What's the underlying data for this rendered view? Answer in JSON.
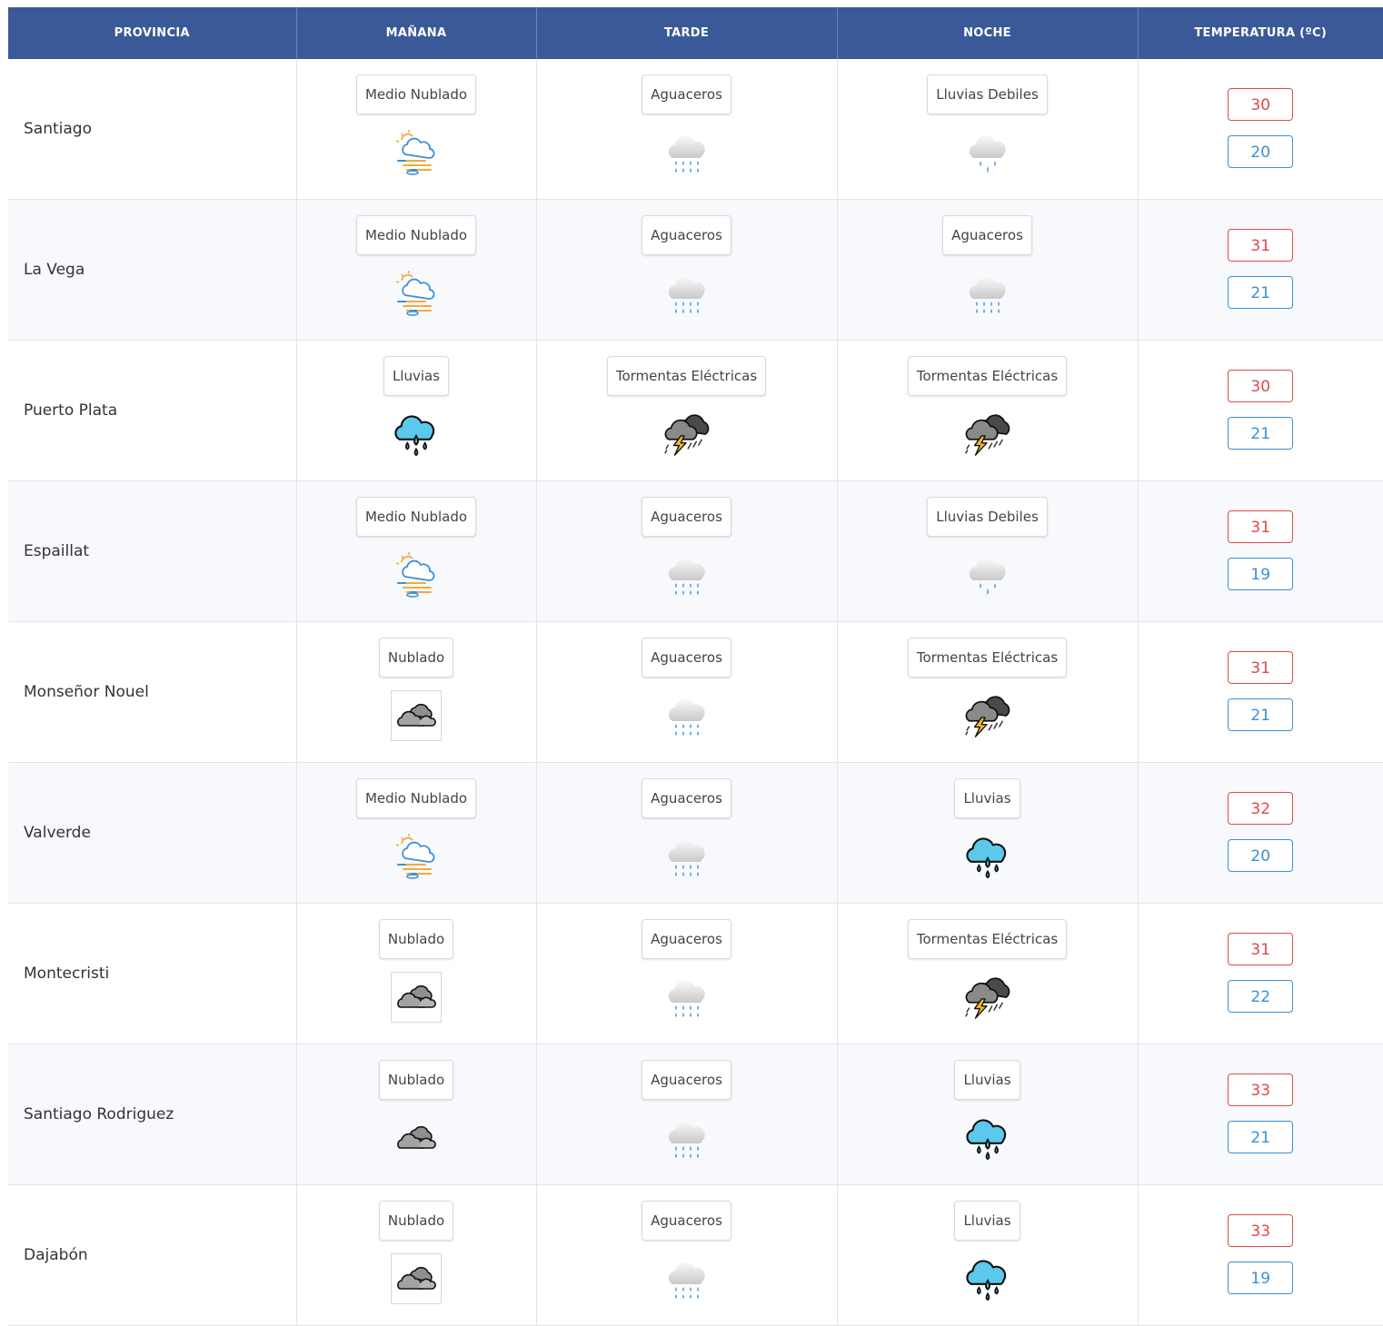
{
  "headers": {
    "provincia": "PROVINCIA",
    "manana": "MAÑANA",
    "tarde": "TARDE",
    "noche": "NOCHE",
    "temperatura": "TEMPERATURA (ºC)"
  },
  "colors": {
    "header_bg": "#3b5998",
    "max_temp": "#e0484a",
    "min_temp": "#3a8fd8"
  },
  "rows": [
    {
      "province": "Santiago",
      "manana": {
        "label": "Medio Nublado",
        "icon": "partly-cloudy-icon"
      },
      "tarde": {
        "label": "Aguaceros",
        "icon": "showers-icon"
      },
      "noche": {
        "label": "Lluvias Debiles",
        "icon": "light-rain-icon"
      },
      "max": "30",
      "min": "20"
    },
    {
      "province": "La Vega",
      "manana": {
        "label": "Medio Nublado",
        "icon": "partly-cloudy-icon"
      },
      "tarde": {
        "label": "Aguaceros",
        "icon": "showers-icon"
      },
      "noche": {
        "label": "Aguaceros",
        "icon": "showers-icon"
      },
      "max": "31",
      "min": "21"
    },
    {
      "province": "Puerto Plata",
      "manana": {
        "label": "Lluvias",
        "icon": "rain-icon"
      },
      "tarde": {
        "label": "Tormentas Eléctricas",
        "icon": "thunderstorm-icon"
      },
      "noche": {
        "label": "Tormentas Eléctricas",
        "icon": "thunderstorm-icon"
      },
      "max": "30",
      "min": "21"
    },
    {
      "province": "Espaillat",
      "manana": {
        "label": "Medio Nublado",
        "icon": "partly-cloudy-icon"
      },
      "tarde": {
        "label": "Aguaceros",
        "icon": "showers-icon"
      },
      "noche": {
        "label": "Lluvias Debiles",
        "icon": "light-rain-icon"
      },
      "max": "31",
      "min": "19"
    },
    {
      "province": "Monseñor Nouel",
      "manana": {
        "label": "Nublado",
        "icon": "cloudy-icon"
      },
      "tarde": {
        "label": "Aguaceros",
        "icon": "showers-icon"
      },
      "noche": {
        "label": "Tormentas Eléctricas",
        "icon": "thunderstorm-icon"
      },
      "max": "31",
      "min": "21"
    },
    {
      "province": "Valverde",
      "manana": {
        "label": "Medio Nublado",
        "icon": "partly-cloudy-icon"
      },
      "tarde": {
        "label": "Aguaceros",
        "icon": "showers-icon"
      },
      "noche": {
        "label": "Lluvias",
        "icon": "rain-icon"
      },
      "max": "32",
      "min": "20"
    },
    {
      "province": "Montecristi",
      "manana": {
        "label": "Nublado",
        "icon": "cloudy-icon"
      },
      "tarde": {
        "label": "Aguaceros",
        "icon": "showers-icon"
      },
      "noche": {
        "label": "Tormentas Eléctricas",
        "icon": "thunderstorm-icon"
      },
      "max": "31",
      "min": "22"
    },
    {
      "province": "Santiago Rodriguez",
      "manana": {
        "label": "Nublado",
        "icon": "cloudy-plain-icon"
      },
      "tarde": {
        "label": "Aguaceros",
        "icon": "showers-icon"
      },
      "noche": {
        "label": "Lluvias",
        "icon": "rain-icon"
      },
      "max": "33",
      "min": "21"
    },
    {
      "province": "Dajabón",
      "manana": {
        "label": "Nublado",
        "icon": "cloudy-icon"
      },
      "tarde": {
        "label": "Aguaceros",
        "icon": "showers-icon"
      },
      "noche": {
        "label": "Lluvias",
        "icon": "rain-icon"
      },
      "max": "33",
      "min": "19"
    }
  ]
}
